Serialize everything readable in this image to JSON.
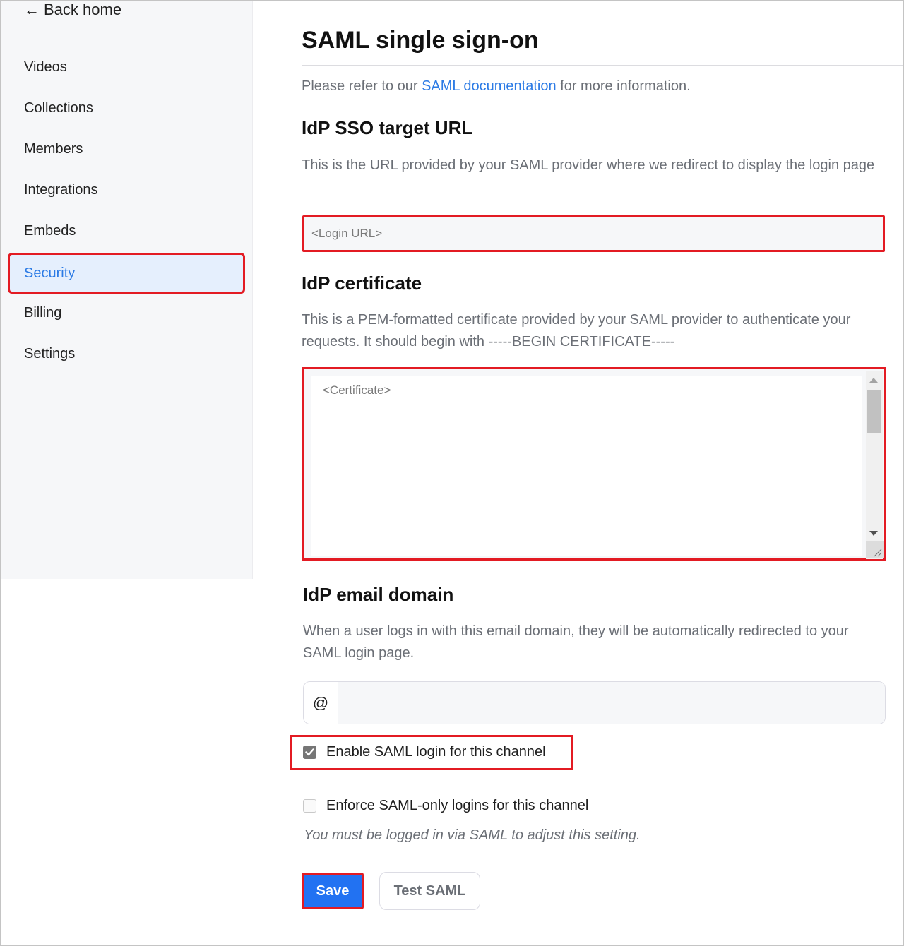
{
  "sidebar": {
    "back_home": {
      "icon": "arrow-left-icon",
      "arrow_glyph": "←",
      "label": "Back home"
    },
    "items": [
      {
        "label": "Videos",
        "active": false
      },
      {
        "label": "Collections",
        "active": false
      },
      {
        "label": "Members",
        "active": false
      },
      {
        "label": "Integrations",
        "active": false
      },
      {
        "label": "Embeds",
        "active": false
      },
      {
        "label": "Security",
        "active": true
      },
      {
        "label": "Billing",
        "active": false
      },
      {
        "label": "Settings",
        "active": false
      }
    ]
  },
  "main": {
    "title": "SAML single sign-on",
    "intro": {
      "prefix": "Please refer to our ",
      "link_text": "SAML documentation",
      "suffix": " for more information."
    },
    "sso_url": {
      "title": "IdP SSO target URL",
      "description": "This is the URL provided by your SAML provider where we redirect to display the login page",
      "placeholder": "<Login URL>",
      "value": ""
    },
    "certificate": {
      "title": "IdP certificate",
      "description": "This is a PEM-formatted certificate provided by your SAML provider to authenticate your requests. It should begin with -----BEGIN CERTIFICATE-----",
      "placeholder": "<Certificate>",
      "value": ""
    },
    "email_domain": {
      "title": "IdP email domain",
      "description": "When a user logs in with this email domain, they will be automatically redirected to your SAML login page.",
      "prefix": "@",
      "value": ""
    },
    "enable_saml": {
      "label": "Enable SAML login for this channel",
      "checked": true
    },
    "enforce_saml": {
      "label": "Enforce SAML-only logins for this channel",
      "checked": false,
      "disabled": true
    },
    "enforce_note": "You must be logged in via SAML to adjust this setting.",
    "buttons": {
      "save": "Save",
      "test": "Test SAML"
    }
  },
  "colors": {
    "accent": "#2c7be5",
    "primary_button": "#2272f2",
    "annotation_red": "#e31b23",
    "active_nav_bg": "#e5effd",
    "sidebar_bg": "#f6f7f9"
  }
}
